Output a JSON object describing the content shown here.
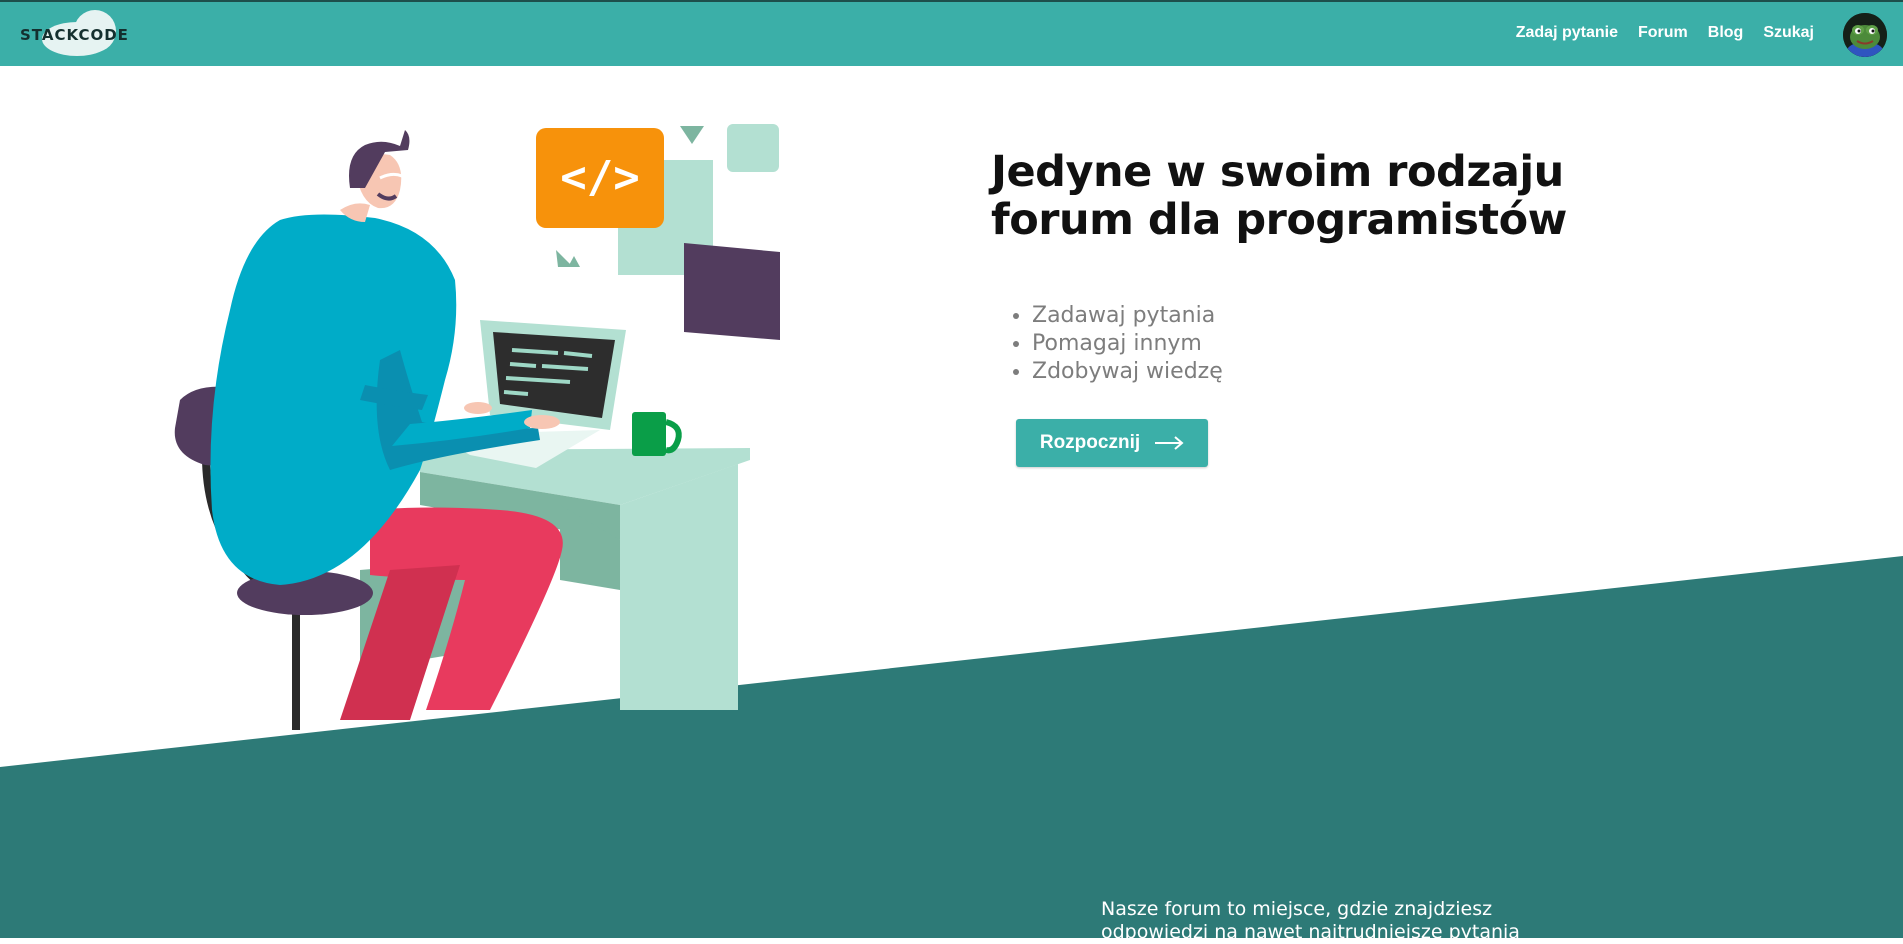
{
  "header": {
    "logo_text": "STACKCODE",
    "nav": {
      "ask": "Zadaj pytanie",
      "forum": "Forum",
      "blog": "Blog",
      "search": "Szukaj"
    },
    "avatar": "frog-avatar"
  },
  "hero": {
    "title_line1": "Jedyne w swoim rodzaju",
    "title_line2": "forum dla programistów",
    "features": [
      "Zadawaj pytania",
      "Pomagaj innym",
      "Zdobywaj wiedzę"
    ],
    "cta_label": "Rozpocznij",
    "cta_icon": "arrow-right-icon",
    "code_badge": "</>"
  },
  "about": {
    "text": "Nasze forum to miejsce, gdzie znajdziesz odpowiedzi na nawet najtrudniejsze pytania"
  },
  "colors": {
    "header": "#3bafa8",
    "band": "#2d7a77",
    "accent_orange": "#f7920b",
    "shirt": "#00acc8",
    "pants": "#e83a5e",
    "purple": "#523c5e",
    "mint": "#b3e0d2"
  }
}
